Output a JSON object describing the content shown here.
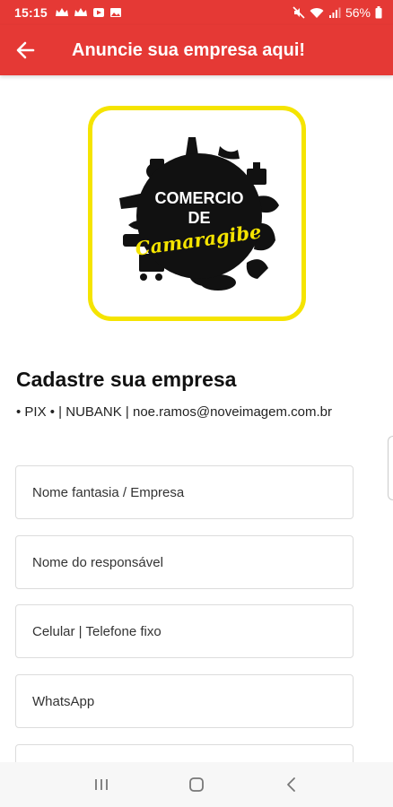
{
  "status_bar": {
    "time": "15:15",
    "battery": "56%"
  },
  "app_bar": {
    "title": "Anuncie sua empresa aqui!",
    "back_icon": "arrow-left-icon"
  },
  "logo": {
    "line1": "COMERCIO",
    "line2": "DE",
    "line3": "Camaragibe"
  },
  "form": {
    "title": "Cadastre sua empresa",
    "pix_info": "• PIX • | NUBANK | noe.ramos@noveimagem.com.br",
    "fields": [
      {
        "placeholder": "Nome fantasia / Empresa"
      },
      {
        "placeholder": "Nome do responsável"
      },
      {
        "placeholder": "Celular | Telefone fixo"
      },
      {
        "placeholder": "WhatsApp"
      },
      {
        "placeholder": ""
      }
    ]
  },
  "colors": {
    "primary": "#e53935",
    "logo_border": "#f5e400",
    "logo_accent": "#f5e400"
  }
}
